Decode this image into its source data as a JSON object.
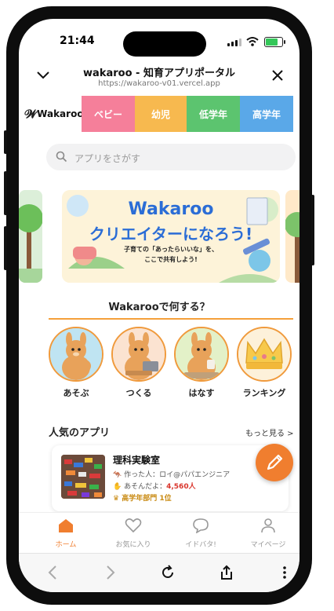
{
  "status_bar": {
    "time": "21:44"
  },
  "browser_header": {
    "title": "wakaroo - 知育アプリポータル",
    "url": "https://wakaroo-v01.vercel.app"
  },
  "tabs": {
    "logo": "Wakaroo",
    "items": [
      {
        "label": "ベビー",
        "color": "#f57f9a"
      },
      {
        "label": "幼児",
        "color": "#f7b94f"
      },
      {
        "label": "低学年",
        "color": "#5cc46f"
      },
      {
        "label": "高学年",
        "color": "#5aa8e8"
      }
    ]
  },
  "search": {
    "placeholder": "アプリをさがす"
  },
  "banner": {
    "title_line1": "Wakaroo",
    "title_line2": "クリエイターになろう!",
    "subtitle_line1": "子育ての「あったらいいな」を、",
    "subtitle_line2": "ここで共有しよう!"
  },
  "section": {
    "title": "Wakarooで何する？"
  },
  "categories": [
    {
      "label": "あそぶ"
    },
    {
      "label": "つくる"
    },
    {
      "label": "はなす"
    },
    {
      "label": "ランキング"
    }
  ],
  "popular": {
    "title": "人気のアプリ",
    "more": "もっと見る >",
    "app": {
      "name": "理科実験室",
      "creator": "作った人：ロイ@パパエンジニア",
      "plays_label": "あそんだよ：",
      "plays": "4,560人",
      "rank": "高学年部門 1位"
    }
  },
  "bottom_nav": [
    {
      "label": "ホーム",
      "icon": "home-icon",
      "active": true
    },
    {
      "label": "お気に入り",
      "icon": "heart-icon"
    },
    {
      "label": "イドバタ!",
      "icon": "chat-icon"
    },
    {
      "label": "マイページ",
      "icon": "user-icon"
    }
  ],
  "colors": {
    "accent": "#f07e2f",
    "banner_blue": "#2b6dd6"
  }
}
